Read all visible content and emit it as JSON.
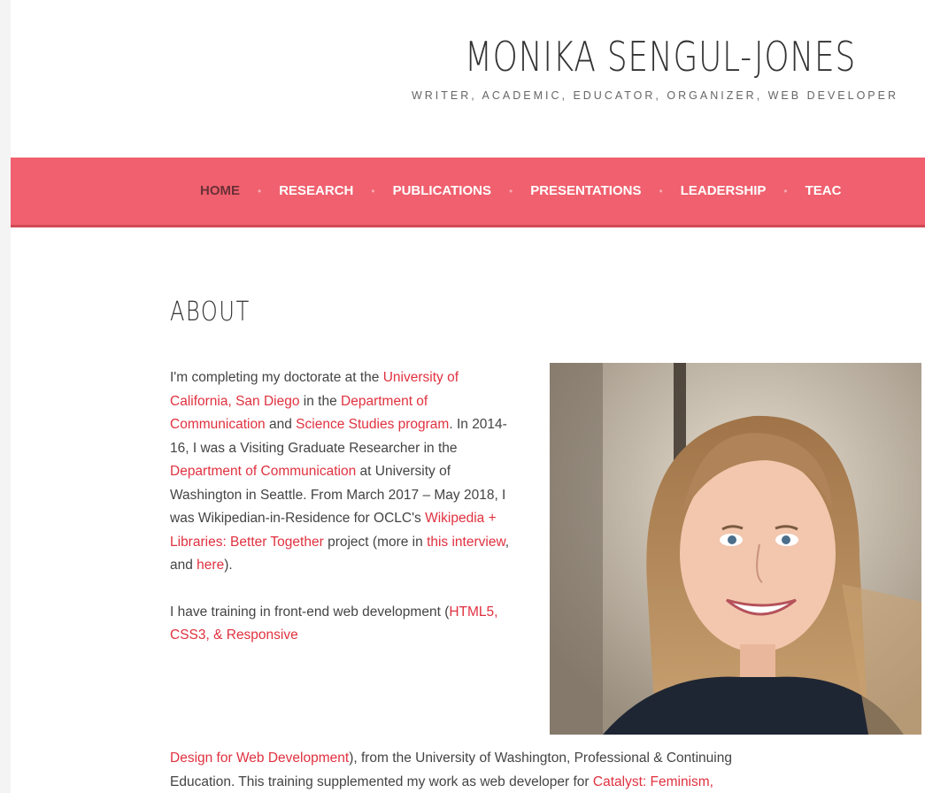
{
  "site": {
    "title": "MONIKA SENGUL-JONES",
    "tagline": "WRITER, ACADEMIC, EDUCATOR, ORGANIZER, WEB DEVELOPER"
  },
  "nav": {
    "items": [
      "HOME",
      "RESEARCH",
      "PUBLICATIONS",
      "PRESENTATIONS",
      "LEADERSHIP",
      "TEAC"
    ],
    "active": "HOME",
    "separator": "•"
  },
  "colors": {
    "accent": "#f0606e",
    "link": "#e0313f"
  },
  "main": {
    "heading": "ABOUT",
    "p1": {
      "t1": "I'm completing my doctorate at the ",
      "l1": "University of California, San Diego",
      "t2": " in the ",
      "l2": "Department of Communication",
      "t3": " and ",
      "l3": "Science Studies program",
      "t4": ". In 2014-16, I was a Visiting Graduate Researcher in the ",
      "l4": "Department of Communication",
      "t5": " at University of Washington in Seattle. From March 2017 – May 2018, I was Wikipedian-in-Residence for OCLC's ",
      "l5": "Wikipedia + Libraries: Better Together",
      "t6": " project (more in ",
      "l6": "this interview",
      "t7": ", and ",
      "l7": "here",
      "t8": ")."
    },
    "p2": {
      "t1": "I have training in front-end web development (",
      "l1": "HTML5, CSS3, & Responsive",
      "l1b": "Design for Web Development",
      "t2": "), from the University of Washington, Professional & Continuing",
      "t3": "Education. This training supplemented my work as web developer for ",
      "l2": "Catalyst: Feminism,"
    },
    "photo_icon": "portrait-photo"
  }
}
